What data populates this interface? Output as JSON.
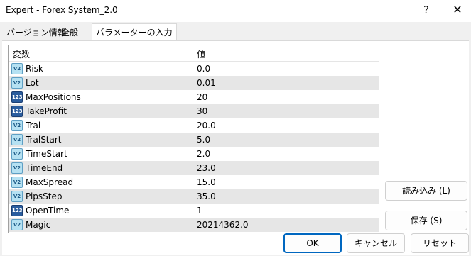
{
  "window": {
    "title": "Expert - Forex System_2.0",
    "help_label": "?",
    "close_label": "✕"
  },
  "tabs": [
    {
      "label": "バージョン情報"
    },
    {
      "label": "全般"
    },
    {
      "label": "パラメーターの入力"
    }
  ],
  "grid": {
    "headers": {
      "variable": "変数",
      "value": "値"
    },
    "rows": [
      {
        "name": "Risk",
        "value": "0.0",
        "icon": "double-icon",
        "icon_text": "V2"
      },
      {
        "name": "Lot",
        "value": "0.01",
        "icon": "double-icon",
        "icon_text": "V2"
      },
      {
        "name": "MaxPositions",
        "value": "20",
        "icon": "integer-icon",
        "icon_text": "123"
      },
      {
        "name": "TakeProfit",
        "value": "30",
        "icon": "integer-icon",
        "icon_text": "123"
      },
      {
        "name": "Tral",
        "value": "20.0",
        "icon": "double-icon",
        "icon_text": "V2"
      },
      {
        "name": "TralStart",
        "value": "5.0",
        "icon": "double-icon",
        "icon_text": "V2"
      },
      {
        "name": "TimeStart",
        "value": "2.0",
        "icon": "double-icon",
        "icon_text": "V2"
      },
      {
        "name": "TimeEnd",
        "value": "23.0",
        "icon": "double-icon",
        "icon_text": "V2"
      },
      {
        "name": "MaxSpread",
        "value": "15.0",
        "icon": "double-icon",
        "icon_text": "V2"
      },
      {
        "name": "PipsStep",
        "value": "35.0",
        "icon": "double-icon",
        "icon_text": "V2"
      },
      {
        "name": "OpenTime",
        "value": "1",
        "icon": "integer-icon",
        "icon_text": "123"
      },
      {
        "name": "Magic",
        "value": "20214362.0",
        "icon": "double-icon",
        "icon_text": "V2"
      }
    ]
  },
  "buttons": {
    "load": "読み込み (L)",
    "save": "保存 (S)",
    "ok": "OK",
    "cancel": "キャンセル",
    "reset": "リセット"
  },
  "colors": {
    "accent": "#0067c0",
    "alt_row": "#e6e6e6",
    "background": "#f0f0f0"
  }
}
